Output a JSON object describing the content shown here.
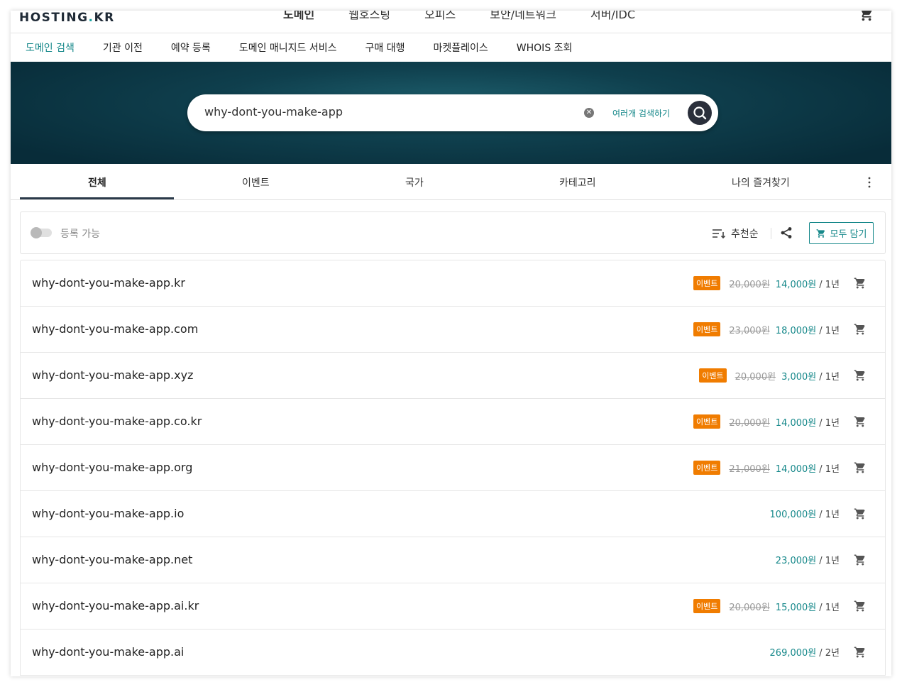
{
  "header": {
    "logo_text": "HOSTING",
    "logo_dot": ".",
    "logo_suffix": "KR",
    "gnb": [
      "도메인",
      "웹호스팅",
      "오피스",
      "보안/네트워크",
      "서버/IDC"
    ]
  },
  "subnav": {
    "items": [
      "도메인 검색",
      "기관 이전",
      "예약 등록",
      "도메인 매니지드 서비스",
      "구매 대행",
      "마켓플레이스",
      "WHOIS 조회"
    ]
  },
  "search": {
    "query": "why-dont-you-make-app",
    "multi_label": "여러개 검색하기"
  },
  "tabs": [
    "전체",
    "이벤트",
    "국가",
    "카테고리",
    "나의 즐겨찾기"
  ],
  "filters": {
    "available_label": "등록 가능",
    "sort_label": "추천순",
    "add_all_label": "모두 담기"
  },
  "colors": {
    "accent": "#16888a",
    "badge": "#f07c00",
    "hero": "#0f3f4d"
  },
  "results": [
    {
      "domain": "why-dont-you-make-app.kr",
      "badge": "이벤트",
      "orig": "20,000원",
      "price": "14,000원",
      "term": "/ 1년"
    },
    {
      "domain": "why-dont-you-make-app.com",
      "badge": "이벤트",
      "orig": "23,000원",
      "price": "18,000원",
      "term": "/ 1년"
    },
    {
      "domain": "why-dont-you-make-app.xyz",
      "badge": "이벤트",
      "orig": "20,000원",
      "price": "3,000원",
      "term": "/ 1년"
    },
    {
      "domain": "why-dont-you-make-app.co.kr",
      "badge": "이벤트",
      "orig": "20,000원",
      "price": "14,000원",
      "term": "/ 1년"
    },
    {
      "domain": "why-dont-you-make-app.org",
      "badge": "이벤트",
      "orig": "21,000원",
      "price": "14,000원",
      "term": "/ 1년"
    },
    {
      "domain": "why-dont-you-make-app.io",
      "badge": "",
      "orig": "",
      "price": "100,000원",
      "term": "/ 1년"
    },
    {
      "domain": "why-dont-you-make-app.net",
      "badge": "",
      "orig": "",
      "price": "23,000원",
      "term": "/ 1년"
    },
    {
      "domain": "why-dont-you-make-app.ai.kr",
      "badge": "이벤트",
      "orig": "20,000원",
      "price": "15,000원",
      "term": "/ 1년"
    },
    {
      "domain": "why-dont-you-make-app.ai",
      "badge": "",
      "orig": "",
      "price": "269,000원",
      "term": "/ 2년"
    }
  ]
}
